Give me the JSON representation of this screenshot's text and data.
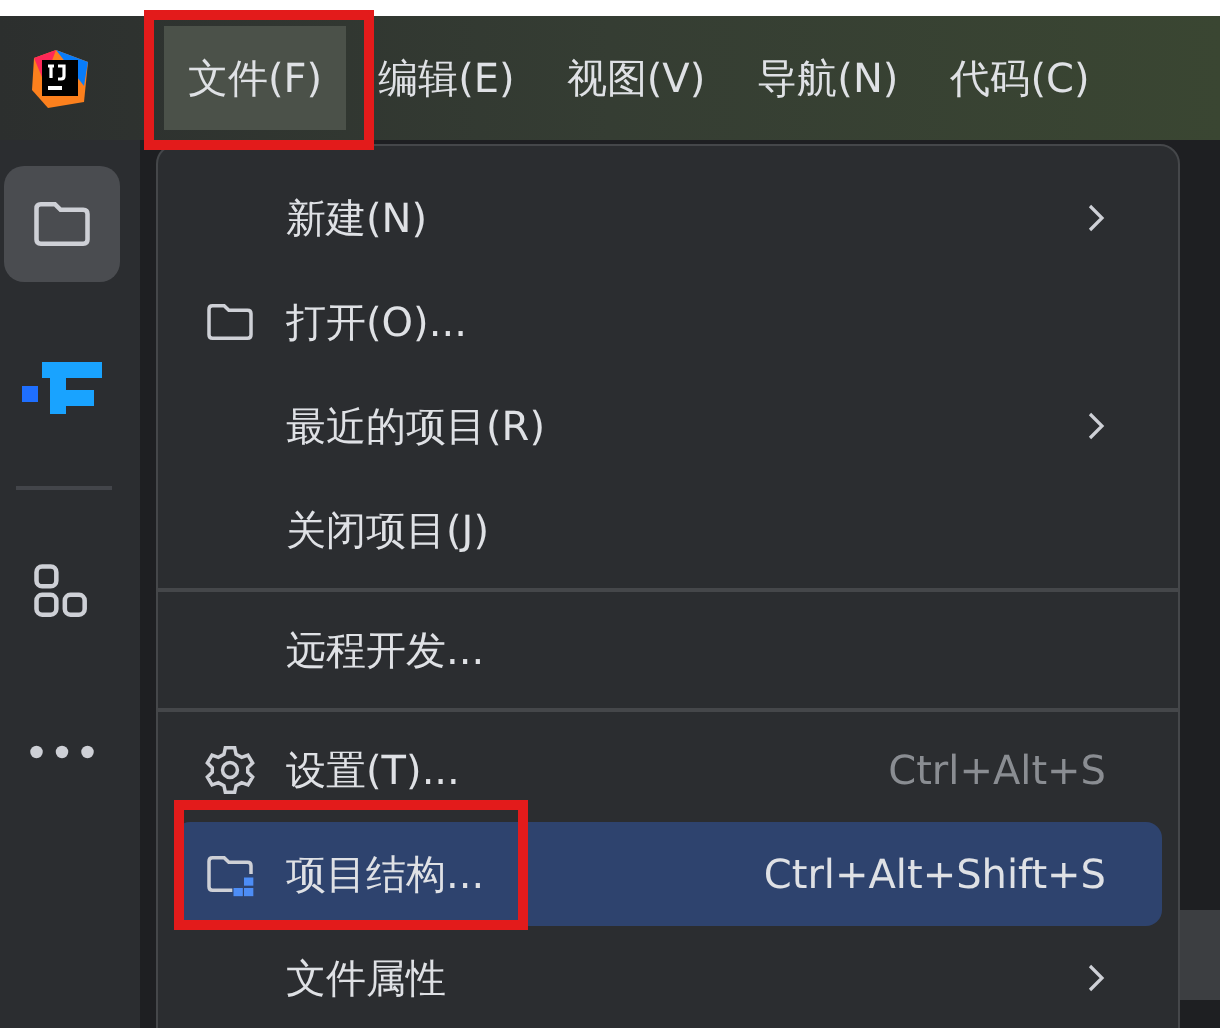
{
  "menu_bar": {
    "items": [
      {
        "label": "文件(F)",
        "selected": true,
        "annotated": true
      },
      {
        "label": "编辑(E)",
        "selected": false
      },
      {
        "label": "视图(V)",
        "selected": false
      },
      {
        "label": "导航(N)",
        "selected": false
      },
      {
        "label": "代码(C)",
        "selected": false
      }
    ]
  },
  "sidebar": {
    "items": [
      {
        "kind": "folder",
        "selected": true
      },
      {
        "kind": "logo",
        "selected": false
      },
      {
        "kind": "grid",
        "selected": false
      },
      {
        "kind": "more",
        "selected": false
      }
    ]
  },
  "file_menu": {
    "items": [
      {
        "kind": "plain",
        "label": "新建(N)",
        "submenu": true,
        "selected": false
      },
      {
        "kind": "folder",
        "label": "打开(O)...",
        "selected": false
      },
      {
        "kind": "plain",
        "label": "最近的项目(R)",
        "submenu": true,
        "selected": false
      },
      {
        "kind": "plain",
        "label": "关闭项目(J)",
        "selected": false
      },
      {
        "kind": "separator"
      },
      {
        "kind": "plain",
        "label": "远程开发...",
        "selected": false
      },
      {
        "kind": "separator"
      },
      {
        "kind": "settings",
        "label": "设置(T)...",
        "shortcut": "Ctrl+Alt+S",
        "selected": false
      },
      {
        "kind": "structure",
        "label": "项目结构...",
        "shortcut": "Ctrl+Alt+Shift+S",
        "selected": true,
        "annotated": true
      },
      {
        "kind": "plain",
        "label": "文件属性",
        "submenu": true,
        "selected": false
      }
    ]
  }
}
